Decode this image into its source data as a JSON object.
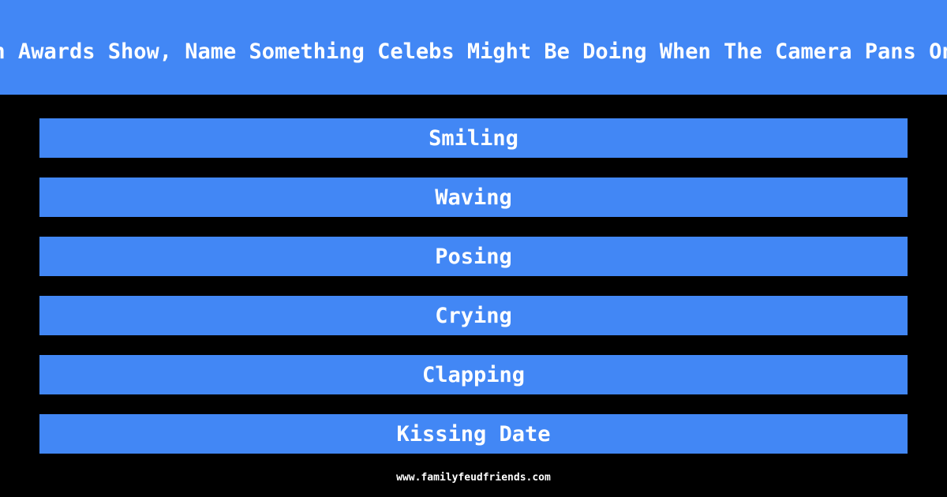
{
  "question": "n Awards Show, Name Something Celebs Might Be Doing When The Camera Pans On",
  "answers": [
    {
      "label": "Smiling"
    },
    {
      "label": "Waving"
    },
    {
      "label": "Posing"
    },
    {
      "label": "Crying"
    },
    {
      "label": "Clapping"
    },
    {
      "label": "Kissing Date"
    }
  ],
  "footer": {
    "site": "www.familyfeudfriends.com"
  },
  "colors": {
    "accent": "#4287f5",
    "background": "#000000",
    "text": "#ffffff"
  }
}
